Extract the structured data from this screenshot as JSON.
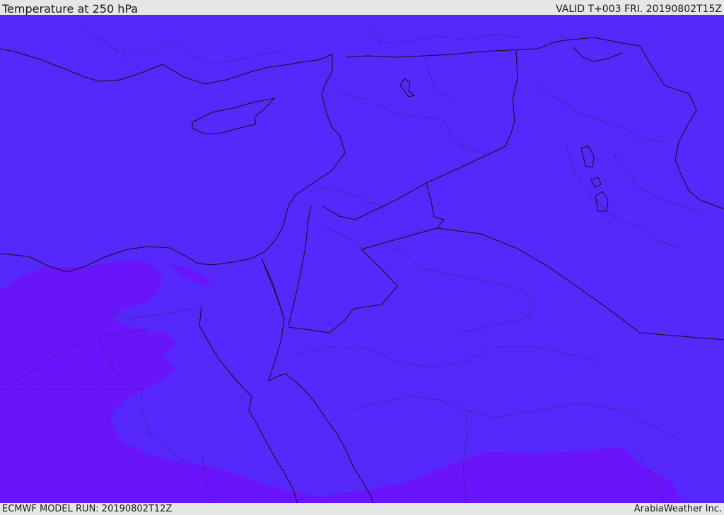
{
  "header": {
    "title": "Temperature at 250 hPa",
    "valid": "VALID T+003 FRI. 20190802T15Z"
  },
  "footer": {
    "model_run": "ECMWF MODEL RUN: 20190802T12Z",
    "credit": "ArabiaWeather Inc."
  },
  "map": {
    "colors": {
      "field_main": "#5728fc",
      "field_warm": "#6a14fb",
      "borders": "#111111"
    }
  }
}
